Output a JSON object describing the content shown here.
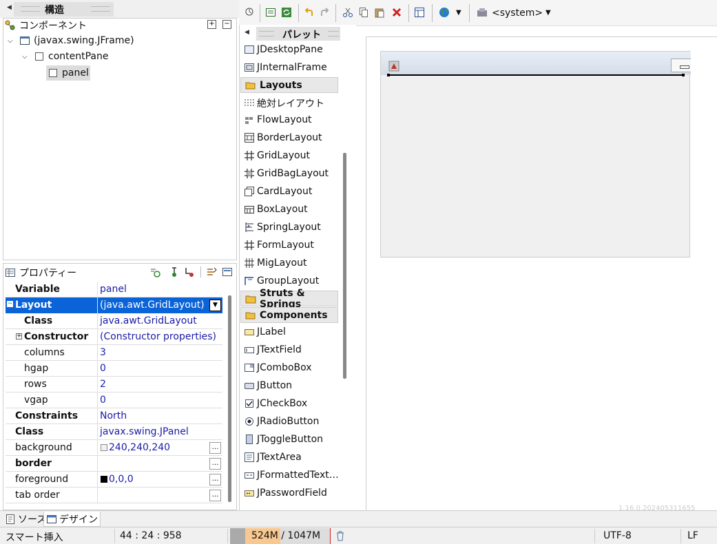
{
  "structure": {
    "title": "構造",
    "components_label": "コンポーネント",
    "tree": [
      {
        "label": "(javax.swing.JFrame)"
      },
      {
        "label": "contentPane"
      },
      {
        "label": "panel"
      }
    ]
  },
  "properties": {
    "title": "プロパティー",
    "rows": [
      {
        "key": "Variable",
        "value": "panel"
      },
      {
        "key": "Layout",
        "value": "(java.awt.GridLayout)"
      },
      {
        "key": "Class",
        "value": "java.awt.GridLayout"
      },
      {
        "key": "Constructor",
        "value": "(Constructor properties)"
      },
      {
        "key": "columns",
        "value": "3"
      },
      {
        "key": "hgap",
        "value": "0"
      },
      {
        "key": "rows",
        "value": "2"
      },
      {
        "key": "vgap",
        "value": "0"
      },
      {
        "key": "Constraints",
        "value": "North"
      },
      {
        "key": "Class",
        "value": "javax.swing.JPanel"
      },
      {
        "key": "background",
        "value": "240,240,240"
      },
      {
        "key": "border",
        "value": ""
      },
      {
        "key": "foreground",
        "value": "0,0,0"
      },
      {
        "key": "tab order",
        "value": ""
      }
    ],
    "ellipsis": "…"
  },
  "toolbar": {
    "system_label": "<system>"
  },
  "palette": {
    "title": "パレット",
    "items_top": [
      "JDesktopPane",
      "JInternalFrame"
    ],
    "layouts_label": "Layouts",
    "layouts": [
      "絶対レイアウト",
      "FlowLayout",
      "BorderLayout",
      "GridLayout",
      "GridBagLayout",
      "CardLayout",
      "BoxLayout",
      "SpringLayout",
      "FormLayout",
      "MigLayout",
      "GroupLayout"
    ],
    "struts_label": "Struts & Springs",
    "components_label": "Components",
    "components": [
      "JLabel",
      "JTextField",
      "JComboBox",
      "JButton",
      "JCheckBox",
      "JRadioButton",
      "JToggleButton",
      "JTextArea",
      "JFormattedText…",
      "JPasswordField"
    ]
  },
  "design": {
    "version_text": "1.16.0.202405311655"
  },
  "bottom_tabs": {
    "source": "ソース",
    "design": "デザイン"
  },
  "status": {
    "mode": "スマート挿入",
    "position": "44 : 24 : 958",
    "memory": "524M / 1047M",
    "encoding": "UTF-8",
    "line_end": "LF"
  }
}
